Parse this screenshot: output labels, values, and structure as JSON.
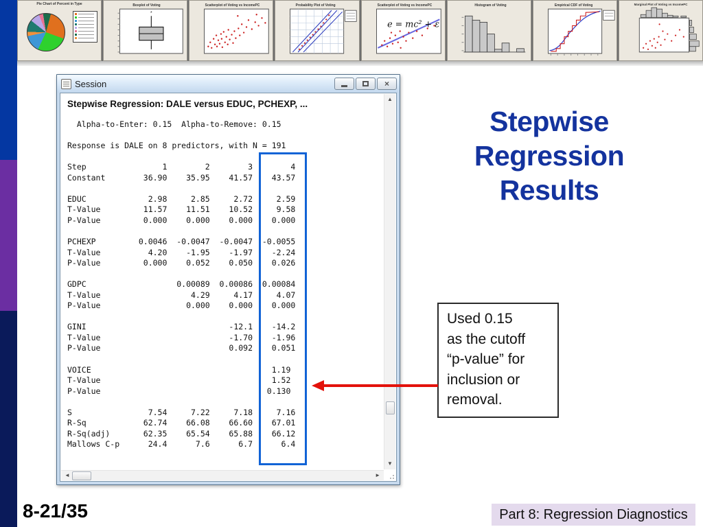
{
  "filmstrip": {
    "thumbnails": [
      {
        "type": "pie-chart",
        "title": "Pie Chart of Percent in Type"
      },
      {
        "type": "boxplot",
        "title": "Boxplot of Voting"
      },
      {
        "type": "scatterplot",
        "title": "Scatterplot of Voting vs IncomePC"
      },
      {
        "type": "probability-plot",
        "title": "Probability Plot of Voting"
      },
      {
        "type": "fitted-line-plot",
        "title": "Scatterplot of Voting vs IncomePC",
        "annotation": "e = mc² + ε"
      },
      {
        "type": "histogram",
        "title": "Histogram of Voting"
      },
      {
        "type": "empirical-cdf",
        "title": "Empirical CDF of Voting"
      },
      {
        "type": "marginal-plot",
        "title": "Marginal Plot of Voting vs IncomePC"
      }
    ]
  },
  "session_window": {
    "title": "Session",
    "window_buttons": {
      "close_glyph": "×"
    },
    "scroll_glyphs": {
      "up": "▲",
      "down": "▼",
      "left": "◄",
      "right": "►"
    },
    "output_title": "Stepwise Regression: DALE versus EDUC, PCHEXP, ...",
    "body_lines": [
      "  Alpha-to-Enter: 0.15  Alpha-to-Remove: 0.15",
      "",
      "Response is DALE on 8 predictors, with N = 191",
      "",
      "Step                1        2        3        4",
      "Constant        36.90    35.95    41.57    43.57",
      "",
      "EDUC             2.98     2.85     2.72     2.59",
      "T-Value         11.57    11.51    10.52     9.58",
      "P-Value         0.000    0.000    0.000    0.000",
      "",
      "PCHEXP         0.0046  -0.0047  -0.0047  -0.0055",
      "T-Value          4.20    -1.95    -1.97    -2.24",
      "P-Value         0.000    0.052    0.050    0.026",
      "",
      "GDPC                   0.00089  0.00086  0.00084",
      "T-Value                   4.29     4.17     4.07",
      "P-Value                  0.000    0.000    0.000",
      "",
      "GINI                              -12.1    -14.2",
      "T-Value                           -1.70    -1.96",
      "P-Value                           0.092    0.051",
      "",
      "VOICE                                      1.19",
      "T-Value                                    1.52",
      "P-Value                                   0.130",
      "",
      "S                7.54     7.22     7.18     7.16",
      "R-Sq            62.74    66.08    66.60    67.01",
      "R-Sq(adj)       62.35    65.54    65.88    66.12",
      "Mallows C-p      24.4      7.6      6.7      6.4"
    ],
    "regression_table": {
      "steps": [
        1,
        2,
        3,
        4
      ],
      "constant": [
        36.9,
        35.95,
        41.57,
        43.57
      ],
      "predictors": [
        {
          "name": "EDUC",
          "coef": [
            2.98,
            2.85,
            2.72,
            2.59
          ],
          "t": [
            11.57,
            11.51,
            10.52,
            9.58
          ],
          "p": [
            0.0,
            0.0,
            0.0,
            0.0
          ]
        },
        {
          "name": "PCHEXP",
          "coef": [
            0.0046,
            -0.0047,
            -0.0047,
            -0.0055
          ],
          "t": [
            4.2,
            -1.95,
            -1.97,
            -2.24
          ],
          "p": [
            0.0,
            0.052,
            0.05,
            0.026
          ]
        },
        {
          "name": "GDPC",
          "coef": [
            null,
            0.00089,
            0.00086,
            0.00084
          ],
          "t": [
            null,
            4.29,
            4.17,
            4.07
          ],
          "p": [
            null,
            0.0,
            0.0,
            0.0
          ]
        },
        {
          "name": "GINI",
          "coef": [
            null,
            null,
            -12.1,
            -14.2
          ],
          "t": [
            null,
            null,
            -1.7,
            -1.96
          ],
          "p": [
            null,
            null,
            0.092,
            0.051
          ]
        },
        {
          "name": "VOICE",
          "coef": [
            null,
            null,
            null,
            1.19
          ],
          "t": [
            null,
            null,
            null,
            1.52
          ],
          "p": [
            null,
            null,
            null,
            0.13
          ]
        }
      ],
      "s": [
        7.54,
        7.22,
        7.18,
        7.16
      ],
      "r_sq": [
        62.74,
        66.08,
        66.6,
        67.01
      ],
      "r_sq_adj": [
        62.35,
        65.54,
        65.88,
        66.12
      ],
      "mallows_cp": [
        24.4,
        7.6,
        6.7,
        6.4
      ]
    }
  },
  "slide": {
    "title": "Stepwise\nRegression\nResults",
    "callout_text": "Used 0.15\nas the cutoff\n“p-value” for\ninclusion or\nremoval.",
    "footer_page": "8-21/35",
    "footer_section": "Part 8: Regression Diagnostics"
  },
  "colors": {
    "title_blue": "#14339e",
    "highlight_blue": "#1163d6",
    "arrow_red": "#e3120b",
    "bar_blue": "#0437a2",
    "bar_purple": "#6b2ea2",
    "bar_navy": "#0a1a5a",
    "footer_section_bg": "#e4daed"
  }
}
